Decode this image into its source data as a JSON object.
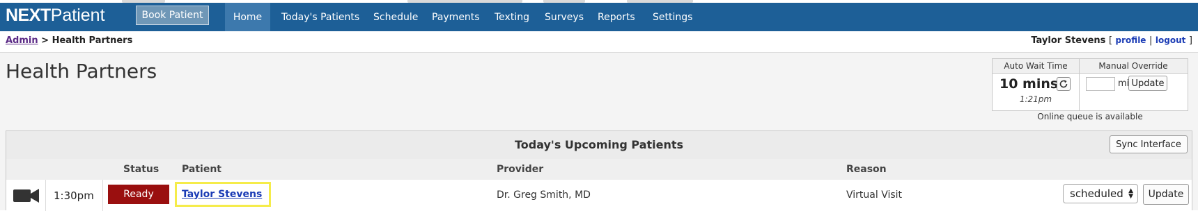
{
  "brand": {
    "logo_next": "NEXT",
    "logo_patient": "Patient"
  },
  "navbar": {
    "book_button": "Book Patient",
    "items": [
      {
        "label": "Home",
        "active": true
      },
      {
        "label": "Today's Patients"
      },
      {
        "label": "Schedule"
      },
      {
        "label": "Payments"
      },
      {
        "label": "Texting"
      },
      {
        "label": "Surveys"
      },
      {
        "label": "Reports"
      },
      {
        "label": "Settings"
      }
    ]
  },
  "breadcrumb": {
    "root": "Admin",
    "separator": ">",
    "current": "Health Partners"
  },
  "user": {
    "name": "Taylor Stevens",
    "open_bracket": "[",
    "profile": "profile",
    "divider": "|",
    "logout": "logout",
    "close_bracket": "]"
  },
  "page": {
    "title": "Health Partners"
  },
  "wait": {
    "auto_header": "Auto Wait Time",
    "override_header": "Manual Override",
    "value": "10 mins",
    "time": "1:21pm",
    "override_value": "",
    "override_unit": "mins",
    "update_label": "Update",
    "queue_note": "Online queue is available",
    "refresh_icon": "refresh-icon"
  },
  "patients": {
    "title": "Today's Upcoming Patients",
    "sync_label": "Sync Interface",
    "columns": {
      "status": "Status",
      "patient": "Patient",
      "provider": "Provider",
      "reason": "Reason"
    },
    "rows": [
      {
        "icon": "video-camera-icon",
        "time": "1:30pm",
        "status": "Ready",
        "patient": "Taylor Stevens",
        "provider": "Dr. Greg Smith, MD",
        "reason": "Virtual Visit",
        "select_value": "scheduled",
        "update_label": "Update"
      }
    ]
  },
  "colors": {
    "navbar": "#1d5f97",
    "nav_active": "#3d79ad",
    "ready_badge": "#9a0f0f",
    "link": "#1a3bb5",
    "highlight": "#f5ec4a"
  }
}
